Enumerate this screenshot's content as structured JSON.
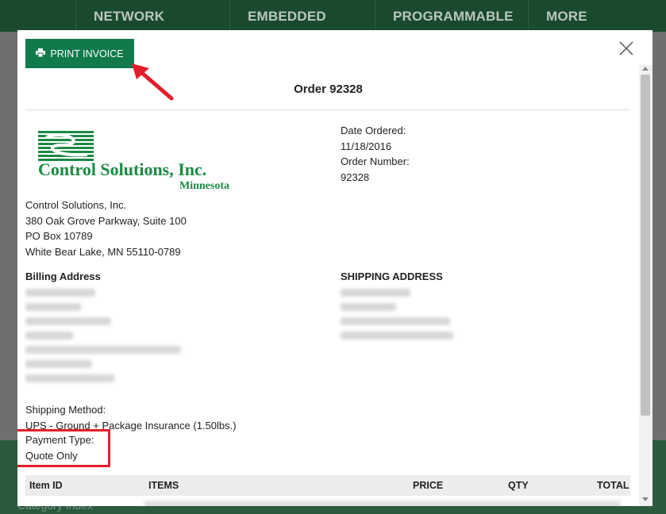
{
  "site_nav": {
    "items": [
      "NETWORK GATEWAYS",
      "EMBEDDED SERVERS",
      "PROGRAMMABLE I/O",
      "MORE"
    ]
  },
  "site_footer": {
    "category_index": "Category Index"
  },
  "modal": {
    "print_button": "PRINT INVOICE",
    "order_title": "Order 92328",
    "logo": {
      "line1": "Control Solutions, Inc.",
      "line2": "Minnesota",
      "color": "#1b8a43"
    },
    "company_address": [
      "Control Solutions, Inc.",
      "380 Oak Grove Parkway, Suite 100",
      "PO Box 10789",
      "White Bear Lake, MN 55110-0789"
    ],
    "order_info": {
      "date_label": "Date Ordered:",
      "date_value": "11/18/2016",
      "number_label": "Order Number:",
      "number_value": "92328"
    },
    "billing_heading": "Billing Address",
    "shipping_heading": "SHIPPING ADDRESS",
    "shipping_method_label": "Shipping Method:",
    "shipping_method_value": "UPS - Ground + Package Insurance (1.50lbs.)",
    "payment_type_label": "Payment Type:",
    "payment_type_value": "Quote Only",
    "table_headers": {
      "item_id": "Item ID",
      "items": "ITEMS",
      "price": "PRICE",
      "qty": "QTY",
      "total": "TOTAL"
    }
  },
  "colors": {
    "brand_green": "#117a4b",
    "highlight_red": "#e31e2b",
    "nav_bg": "#1a4a2e"
  }
}
